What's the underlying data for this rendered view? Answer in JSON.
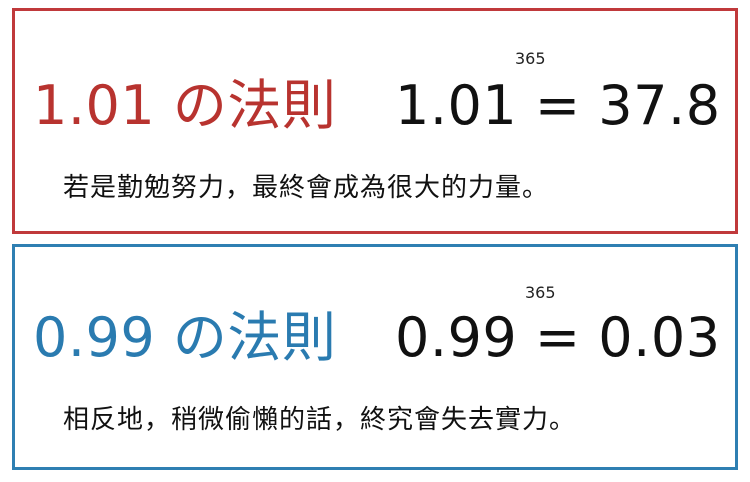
{
  "colors": {
    "top_border": "#c0393b",
    "top_title": "#b8332f",
    "bottom_border": "#2e7fb2",
    "bottom_title": "#2a7bb0",
    "text": "#111111"
  },
  "panels": [
    {
      "title": "1.01 の法則",
      "formula": "1.01 = 37.8",
      "exponent": "365",
      "sentence": "若是勤勉努力，最終會成為很大的力量。"
    },
    {
      "title": "0.99 の法則",
      "formula": "0.99 = 0.03",
      "exponent": "365",
      "sentence": "相反地，稍微偷懶的話，終究會失去實力。"
    }
  ]
}
